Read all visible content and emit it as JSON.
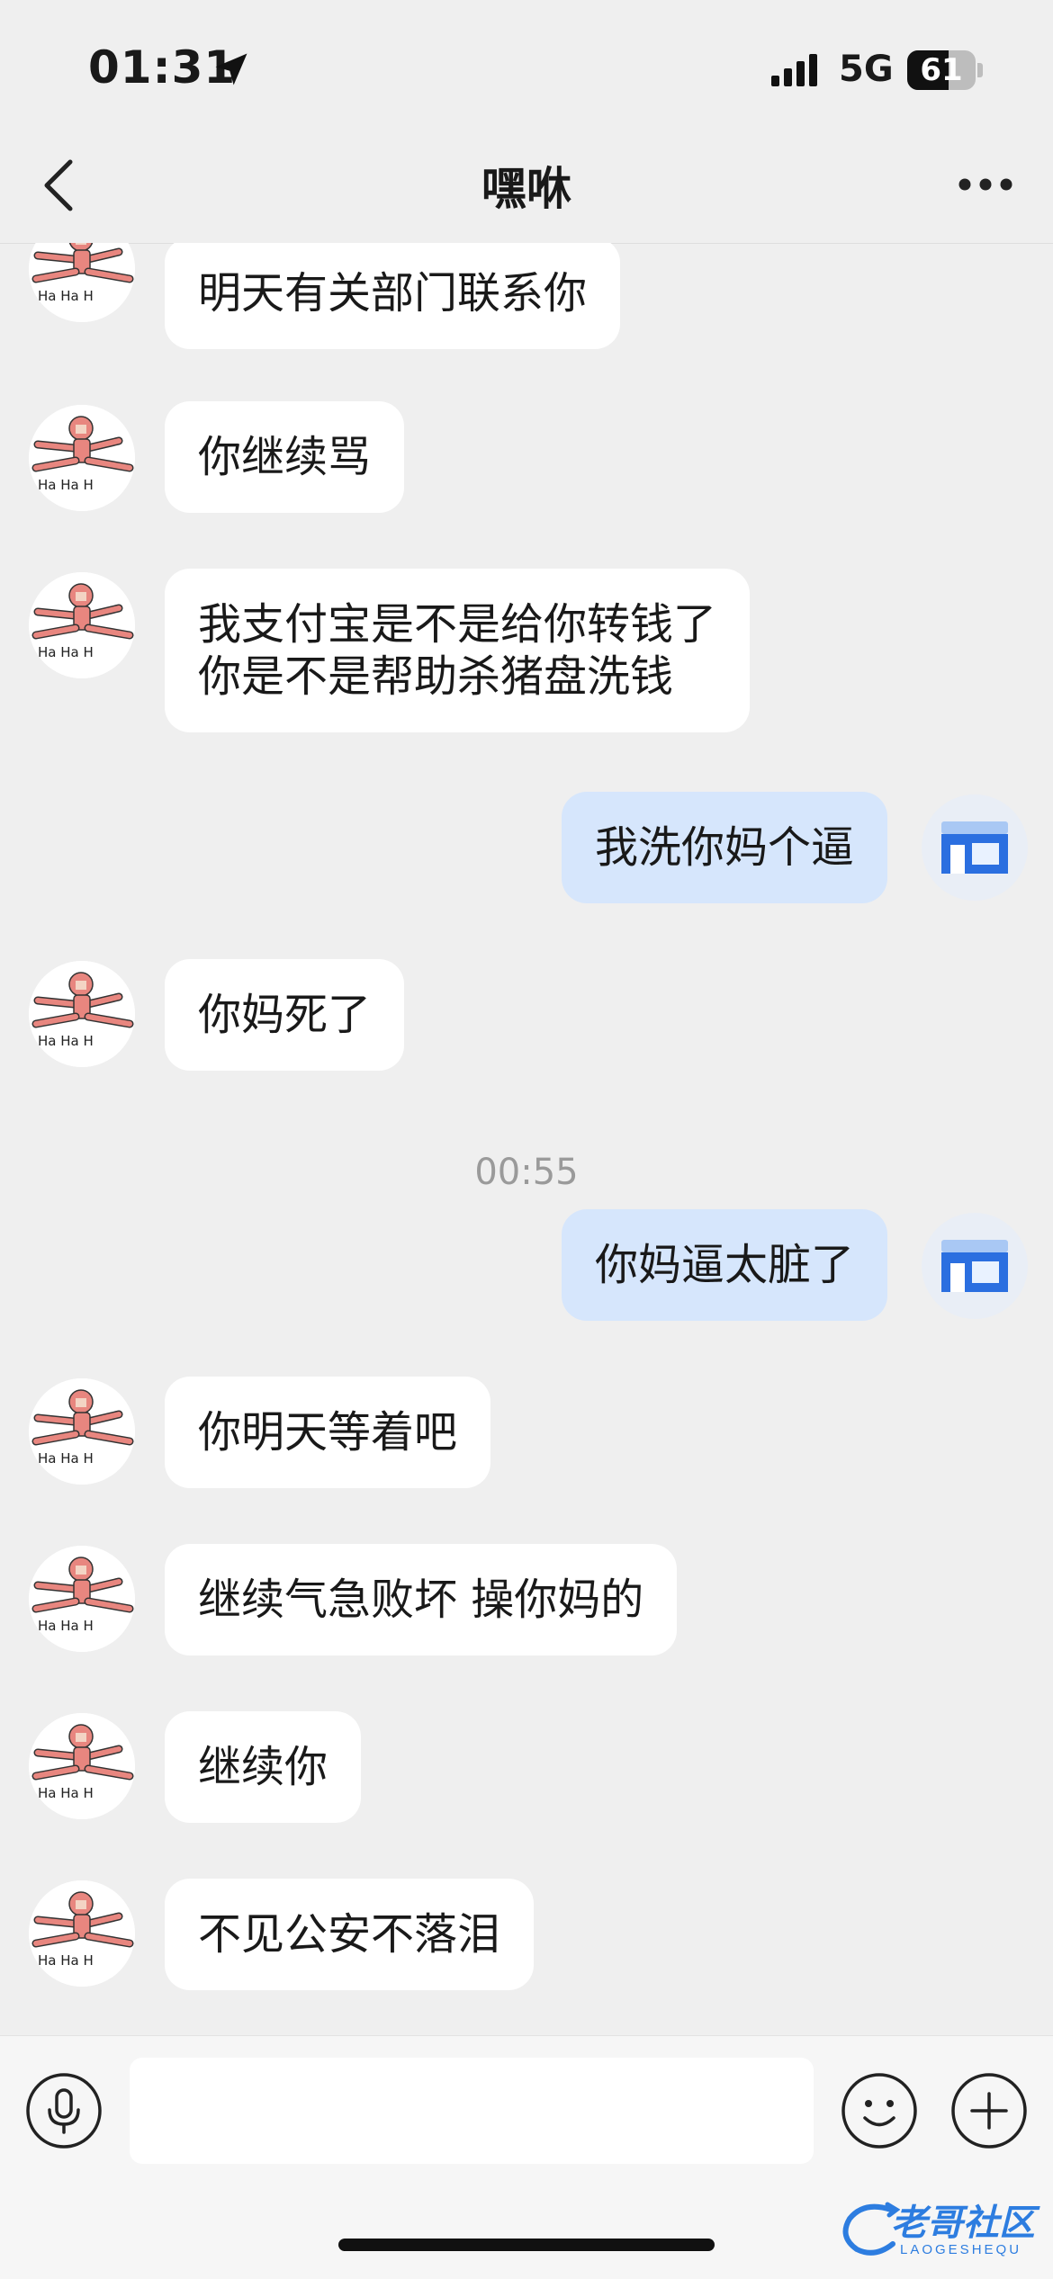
{
  "status_bar": {
    "time": "01:31",
    "network": "5G",
    "battery": "61",
    "battery_level": 0.61
  },
  "nav": {
    "title": "嘿咻"
  },
  "messages": [
    {
      "from": "other",
      "text": "明天有关部门联系你"
    },
    {
      "from": "other",
      "text": "你继续骂"
    },
    {
      "from": "other",
      "text": "我支付宝是不是给你转钱了\n你是不是帮助杀猪盘洗钱"
    },
    {
      "from": "self",
      "text": "我洗你妈个逼"
    },
    {
      "from": "other",
      "text": "你妈死了"
    },
    {
      "timestamp": "00:55"
    },
    {
      "from": "self",
      "text": "你妈逼太脏了"
    },
    {
      "from": "other",
      "text": "你明天等着吧"
    },
    {
      "from": "other",
      "text": "继续气急败坏 操你妈的"
    },
    {
      "from": "other",
      "text": "继续你"
    },
    {
      "from": "other",
      "text": "不见公安不落泪"
    }
  ],
  "input": {
    "value": "",
    "placeholder": ""
  },
  "avatar_other_text": "Ha Ha H",
  "watermark": {
    "title": "老哥社区",
    "subtitle": "LAOGESHEQU"
  },
  "colors": {
    "background": "#efefef",
    "self_bubble": "#d6e6fc",
    "other_bubble": "#ffffff",
    "accent": "#2d7de0"
  }
}
